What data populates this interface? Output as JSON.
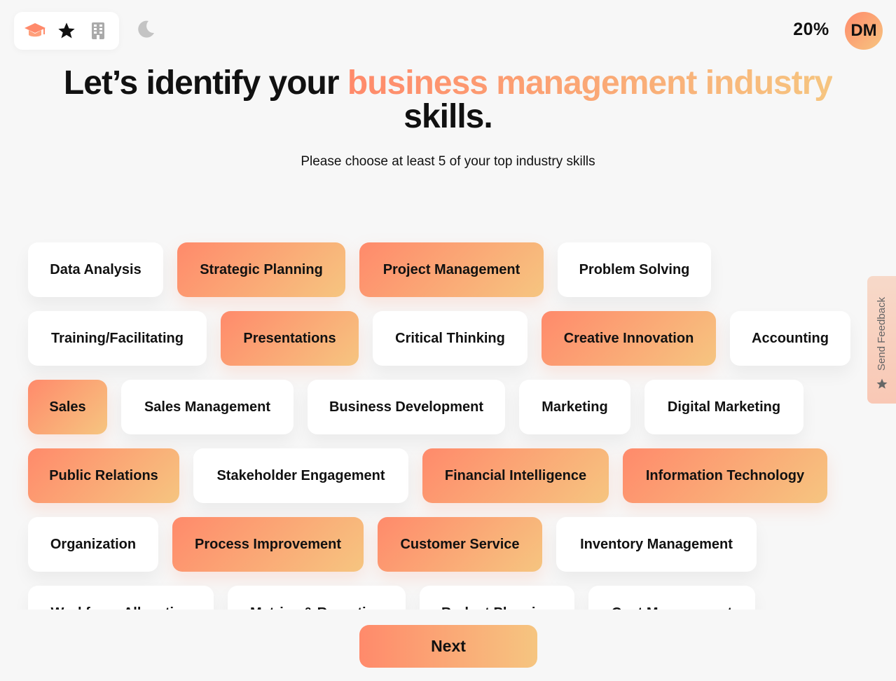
{
  "header": {
    "progress": "20%",
    "avatar_initials": "DM",
    "icons": [
      "graduation-cap-icon",
      "star-icon",
      "building-icon",
      "moon-icon"
    ],
    "accent_color": "#ff8a6b",
    "accent_color_end": "#f6c580"
  },
  "headline": {
    "prefix": "Let’s identify your ",
    "highlight": "business management industry",
    "suffix": "skills."
  },
  "subtitle": "Please choose at least 5 of your top industry skills",
  "skills": [
    {
      "label": "Data Analysis",
      "selected": false
    },
    {
      "label": "Strategic Planning",
      "selected": true
    },
    {
      "label": "Project Management",
      "selected": true
    },
    {
      "label": "Problem Solving",
      "selected": false
    },
    {
      "label": "Training/Facilitating",
      "selected": false
    },
    {
      "label": "Presentations",
      "selected": true
    },
    {
      "label": "Critical Thinking",
      "selected": false
    },
    {
      "label": "Creative Innovation",
      "selected": true
    },
    {
      "label": "Accounting",
      "selected": false
    },
    {
      "label": "Sales",
      "selected": true
    },
    {
      "label": "Sales Management",
      "selected": false
    },
    {
      "label": "Business Development",
      "selected": false
    },
    {
      "label": "Marketing",
      "selected": false
    },
    {
      "label": "Digital Marketing",
      "selected": false
    },
    {
      "label": "Public Relations",
      "selected": true
    },
    {
      "label": "Stakeholder Engagement",
      "selected": false
    },
    {
      "label": "Financial Intelligence",
      "selected": true
    },
    {
      "label": "Information Technology",
      "selected": true
    },
    {
      "label": "Organization",
      "selected": false
    },
    {
      "label": "Process Improvement",
      "selected": true
    },
    {
      "label": "Customer Service",
      "selected": true
    },
    {
      "label": "Inventory Management",
      "selected": false
    },
    {
      "label": "Workforce Allocation",
      "selected": false
    },
    {
      "label": "Metrics & Reporting",
      "selected": false
    },
    {
      "label": "Budget Planning",
      "selected": false
    },
    {
      "label": "Cost Management",
      "selected": false
    }
  ],
  "next_label": "Next",
  "feedback_label": "Send Feedback"
}
